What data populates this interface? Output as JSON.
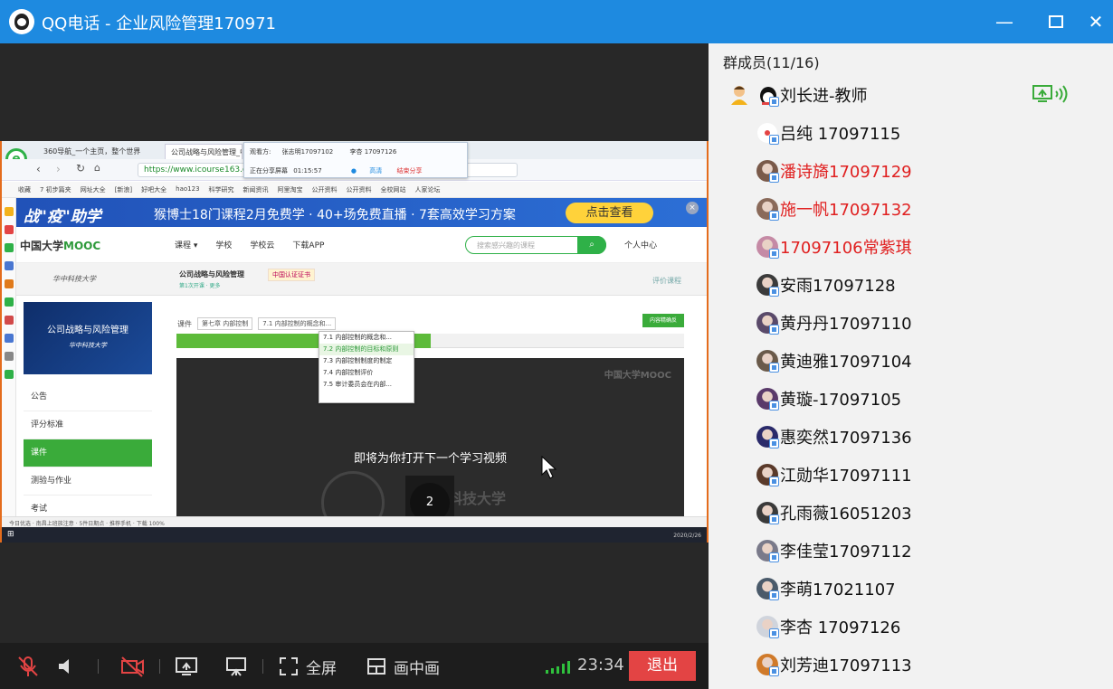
{
  "window": {
    "title": "QQ电话 - 企业风险管理170971",
    "minimize": "—",
    "maximize": "☐",
    "close": "✕"
  },
  "shared_screen": {
    "browser_tabs": [
      "360导航_一个主页，整个世界",
      "公司战略与风险管理_中国大学MOOC"
    ],
    "url": "https://www.icourse163.org",
    "bookmarks": [
      "收藏",
      "7 初步篇夹",
      "网址大全",
      "[新浪]",
      "好吧大全",
      "hao123",
      "科学研究",
      "新闻资讯",
      "阿里淘宝",
      "公开资料",
      "公开资料",
      "全校网站",
      "人家论坛"
    ],
    "share_panel": {
      "viewer_label": "观看方:",
      "viewer_name": "张志明17097102",
      "sharer": "李杏 17097126",
      "sharing_time_label": "正在分享屏幕",
      "sharing_time": "01:15:57",
      "hd": "高清",
      "stop": "结束分享"
    },
    "banner": {
      "left": "战\"疫\"助学",
      "mid": "猴博士18门课程2月免费学 · 40+场免费直播 · 7套高效学习方案",
      "button": "点击查看",
      "close": "×"
    },
    "mooc": {
      "logo_prefix": "中国大学",
      "logo_suffix": "MOOC",
      "nav": [
        "课程 ▾",
        "学校",
        "学校云",
        "下载APP"
      ],
      "search_placeholder": "搜索感兴趣的课程",
      "search_icon": "⌕",
      "user_center": "个人中心"
    },
    "course": {
      "school": "华中科技大学",
      "name": "公司战略与风险管理",
      "meta": "第1次开课  · 更多",
      "badge": "中国认证证书",
      "evaluate": "评价课程",
      "thumb_title": "公司战略与风险管理",
      "thumb_school": "华中科技大学",
      "menu": [
        "公告",
        "评分标准",
        "课件",
        "测验与作业",
        "考试"
      ],
      "selected_menu": "课件",
      "crumb_label": "课件",
      "chapter_select": "第七章 内部控制",
      "section_select": "7.1 内部控制的概念和...",
      "crumb_button": "内容精确反",
      "dropdown": [
        "7.1 内部控制的概念和...",
        "7.2 内部控制的目标和原则",
        "7.3 内部控制制度的制定",
        "7.4 内部控制评价",
        "7.5 审计委员会在内部..."
      ],
      "player_watermark": "中国大学MOOC",
      "next_video_text": "即将为你打开下一个学习视频",
      "countdown": "2",
      "seal_text": "科技大学"
    },
    "status_bar": "今日优选   · 南昌上班族注意   ·   5件日期点   · 推荐手机   · 下载   100%",
    "taskbar_clock": "2020/2/26"
  },
  "controls": {
    "fullscreen": "全屏",
    "pip": "画中画",
    "time": "23:34",
    "exit": "退出",
    "icons": [
      "mic-muted-icon",
      "speaker-icon",
      "camera-off-icon",
      "screen-share-icon",
      "presentation-icon",
      "fullscreen-icon",
      "picture-in-picture-icon"
    ],
    "signal_color": "#2fc13d",
    "exit_color": "#e34444"
  },
  "members": {
    "title": "群成员(11/16)",
    "list": [
      {
        "name": "刘长进-教师",
        "red": false,
        "teacher": true
      },
      {
        "name": "吕纯 17097115",
        "red": false
      },
      {
        "name": "潘诗旖17097129",
        "red": true
      },
      {
        "name": "施一帆17097132",
        "red": true
      },
      {
        "name": "17097106常紫琪",
        "red": true
      },
      {
        "name": "安雨17097128",
        "red": false
      },
      {
        "name": "黄丹丹17097110",
        "red": false
      },
      {
        "name": "黄迪雅17097104",
        "red": false
      },
      {
        "name": "黄璇-17097105",
        "red": false
      },
      {
        "name": "惠奕然17097136",
        "red": false
      },
      {
        "name": "江勋华17097111",
        "red": false
      },
      {
        "name": "孔雨薇16051203",
        "red": false
      },
      {
        "name": "李佳莹17097112",
        "red": false
      },
      {
        "name": "李萌17021107",
        "red": false
      },
      {
        "name": "李杏 17097126",
        "red": false
      },
      {
        "name": "刘芳迪17097113",
        "red": false
      }
    ],
    "accent": "#1e8ae0",
    "red_name_color": "#e02020"
  }
}
